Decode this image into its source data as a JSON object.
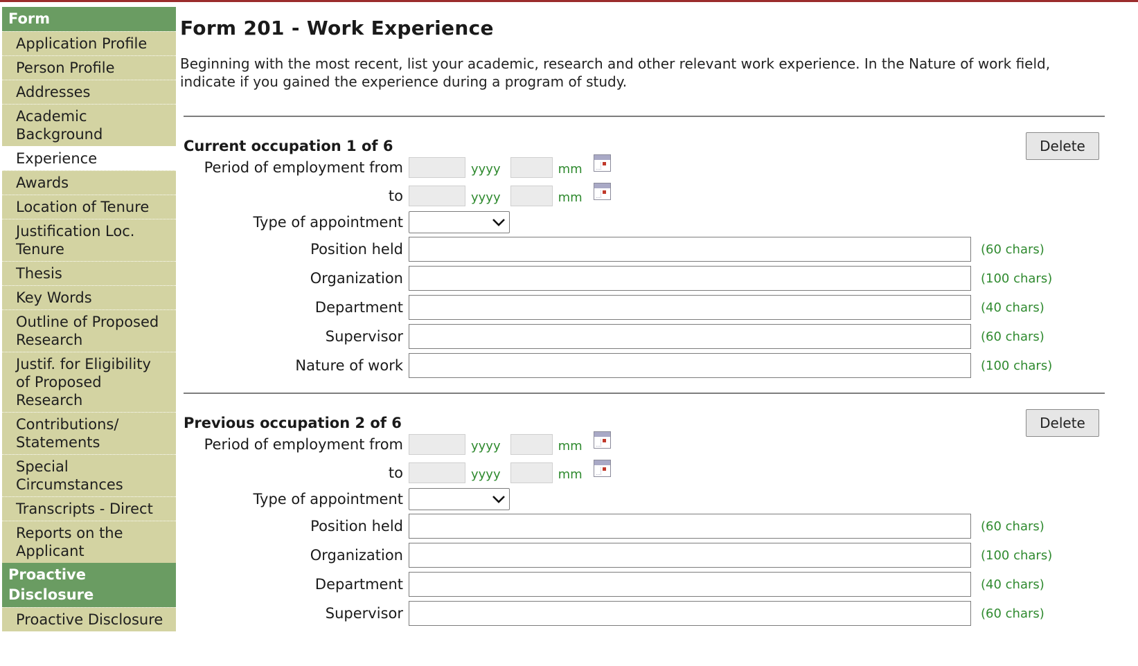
{
  "sidebar": {
    "sections": [
      {
        "header": "Form",
        "items": [
          {
            "label": "Application Profile",
            "active": false
          },
          {
            "label": "Person Profile",
            "active": false
          },
          {
            "label": "Addresses",
            "active": false
          },
          {
            "label": "Academic Background",
            "active": false
          },
          {
            "label": "Experience",
            "active": true
          },
          {
            "label": "Awards",
            "active": false
          },
          {
            "label": "Location of Tenure",
            "active": false
          },
          {
            "label": "Justification Loc. Tenure",
            "active": false
          },
          {
            "label": "Thesis",
            "active": false
          },
          {
            "label": "Key Words",
            "active": false
          },
          {
            "label": "Outline of Proposed Research",
            "active": false
          },
          {
            "label": "Justif. for Eligibility of Proposed Research",
            "active": false
          },
          {
            "label": "Contributions/ Statements",
            "active": false
          },
          {
            "label": "Special Circumstances",
            "active": false
          },
          {
            "label": "Transcripts - Direct",
            "active": false
          },
          {
            "label": "Reports on the Applicant",
            "active": false
          }
        ]
      },
      {
        "header": "Proactive Disclosure",
        "items": [
          {
            "label": "Proactive Disclosure",
            "active": false
          }
        ]
      }
    ]
  },
  "page": {
    "title": "Form 201 - Work Experience",
    "intro": "Beginning with the most recent, list your academic, research and other relevant work experience. In the Nature of work field, indicate if you gained the experience during a program of study."
  },
  "labels": {
    "period_from": "Period of employment from",
    "period_to": "to",
    "yyyy": "yyyy",
    "mm": "mm",
    "type_of_appointment": "Type of appointment",
    "delete": "Delete"
  },
  "icons": {
    "calendar": "calendar-icon",
    "dropdown": "chevron-down-icon"
  },
  "colors": {
    "sidebar_header": "#6a9c62",
    "sidebar_item": "#d3d3a2",
    "hint_green": "#2f8a2f",
    "top_rule": "#9b2c2c"
  },
  "occupations": [
    {
      "title": "Current occupation 1 of 6",
      "from_year": "",
      "from_month": "",
      "to_year": "",
      "to_month": "",
      "type_of_appointment": "",
      "fields": [
        {
          "label": "Position held",
          "value": "",
          "hint": "(60 chars)"
        },
        {
          "label": "Organization",
          "value": "",
          "hint": "(100 chars)"
        },
        {
          "label": "Department",
          "value": "",
          "hint": "(40 chars)"
        },
        {
          "label": "Supervisor",
          "value": "",
          "hint": "(60 chars)"
        },
        {
          "label": "Nature of work",
          "value": "",
          "hint": "(100 chars)"
        }
      ]
    },
    {
      "title": "Previous occupation 2 of 6",
      "from_year": "",
      "from_month": "",
      "to_year": "",
      "to_month": "",
      "type_of_appointment": "",
      "fields": [
        {
          "label": "Position held",
          "value": "",
          "hint": "(60 chars)"
        },
        {
          "label": "Organization",
          "value": "",
          "hint": "(100 chars)"
        },
        {
          "label": "Department",
          "value": "",
          "hint": "(40 chars)"
        },
        {
          "label": "Supervisor",
          "value": "",
          "hint": "(60 chars)"
        }
      ]
    }
  ]
}
